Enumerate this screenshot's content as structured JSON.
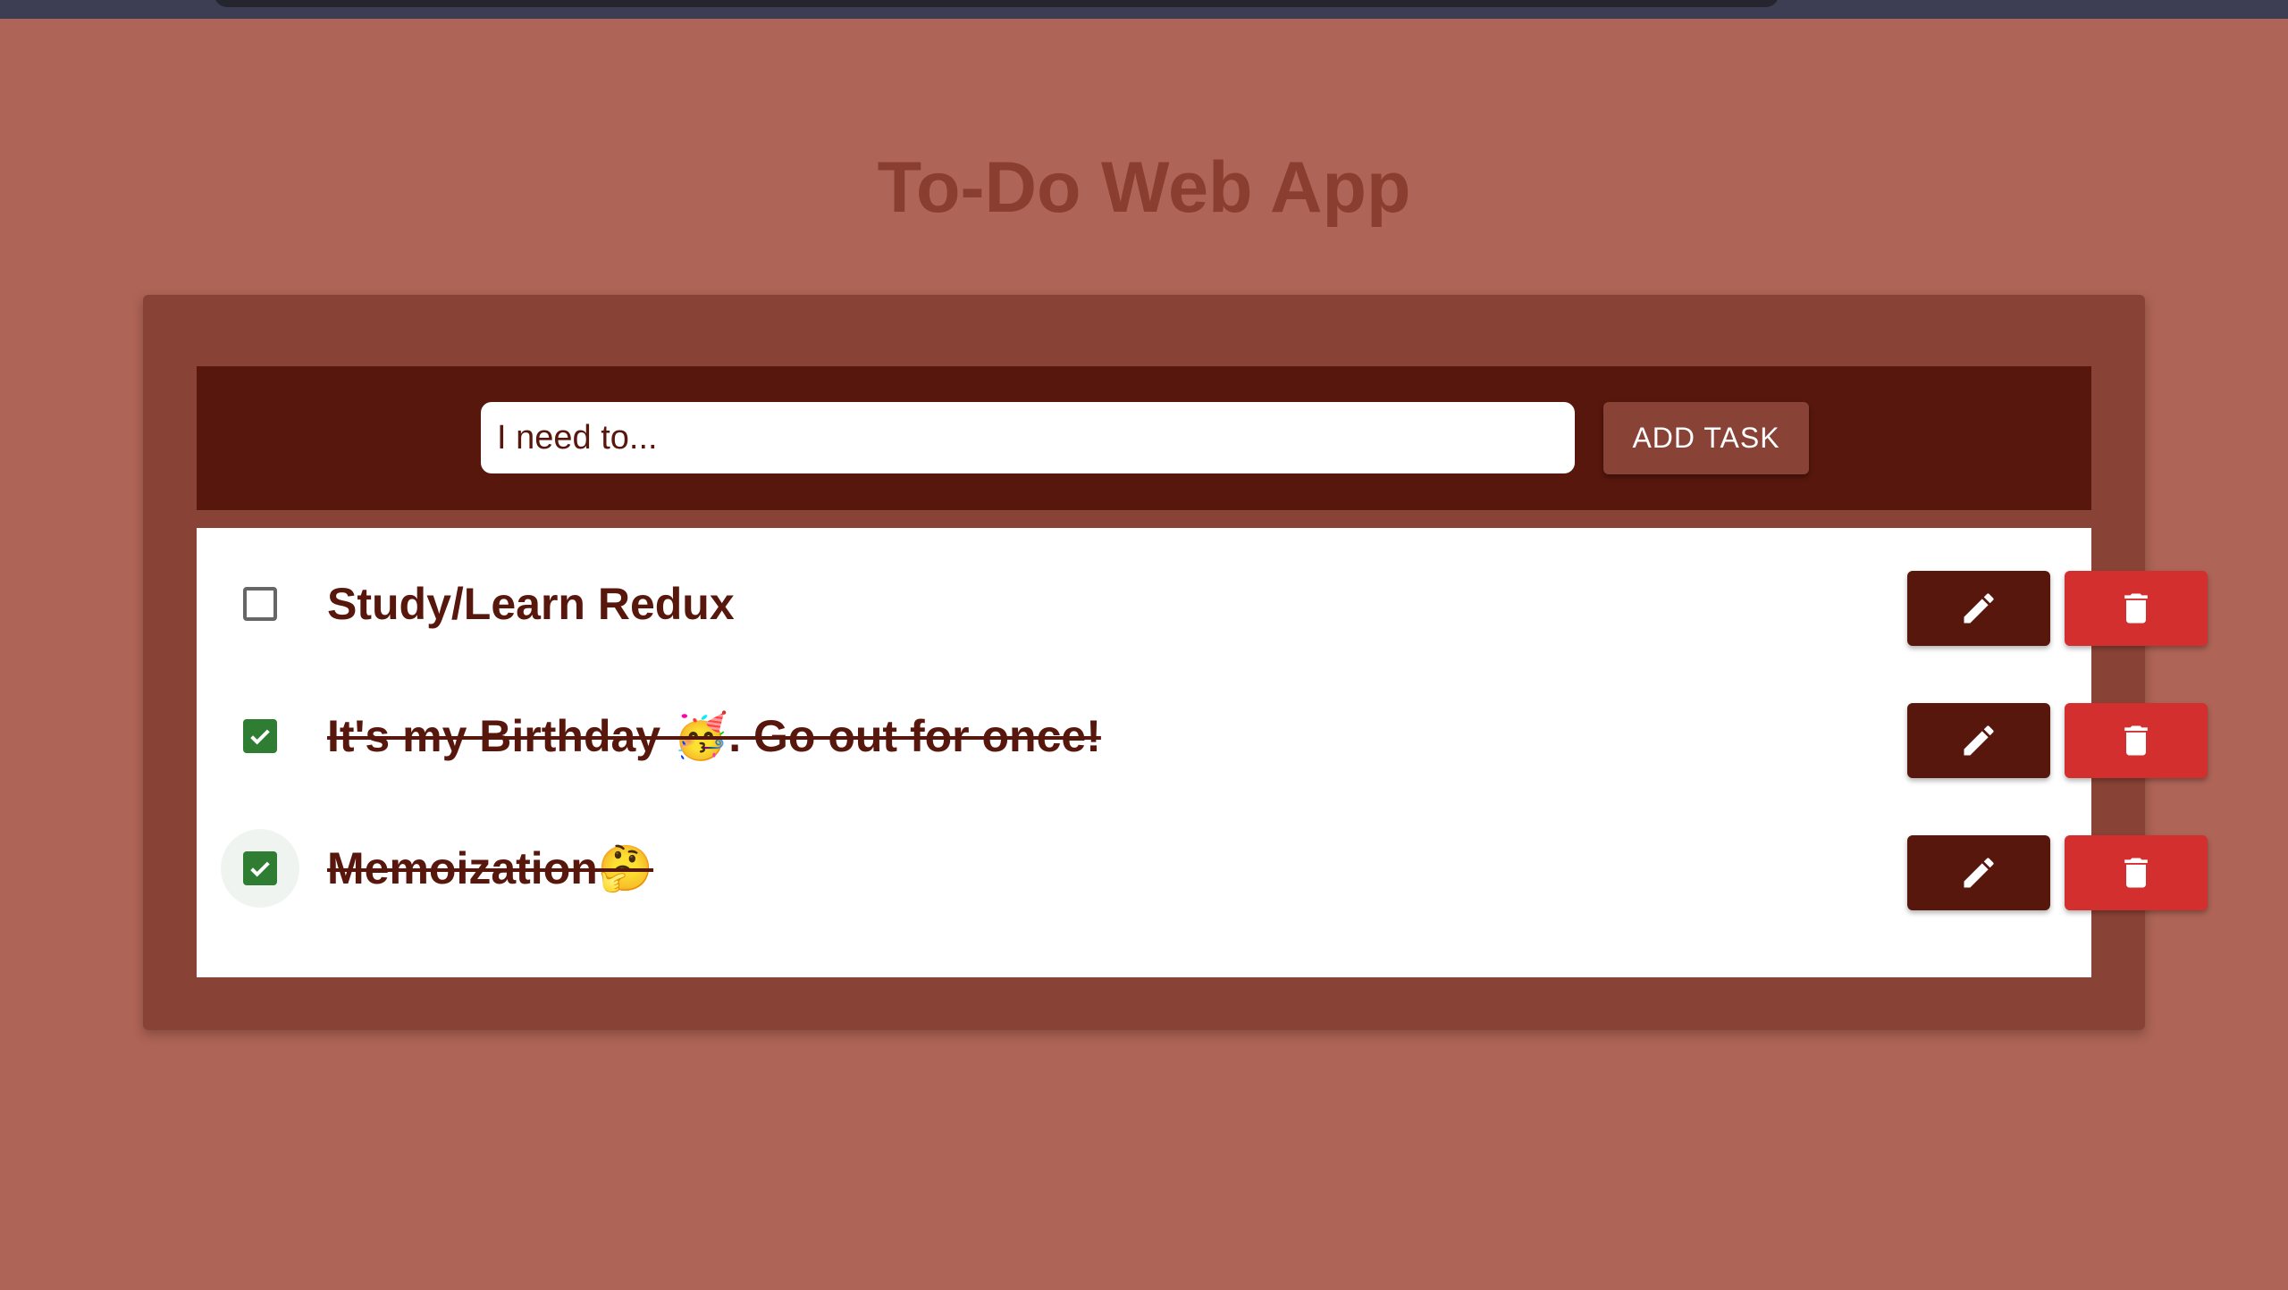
{
  "app": {
    "title": "To-Do Web App"
  },
  "form": {
    "input_placeholder": "I need to...",
    "input_value": "",
    "add_button_label": "ADD TASK"
  },
  "tasks": [
    {
      "text": "Study/Learn Redux",
      "completed": false
    },
    {
      "text": "It's my Birthday 🥳. Go out for once!",
      "completed": true
    },
    {
      "text": "Memoization🤔",
      "completed": true
    }
  ],
  "icons": {
    "edit": "pencil-icon",
    "delete": "trash-icon",
    "check": "checkmark-icon"
  },
  "colors": {
    "page_background": "#ae6456",
    "card_background": "#894336",
    "dark_accent": "#57170d",
    "delete_red": "#d32f2f",
    "checkbox_green": "#2e7d32",
    "title_color": "#8a3e2f"
  }
}
